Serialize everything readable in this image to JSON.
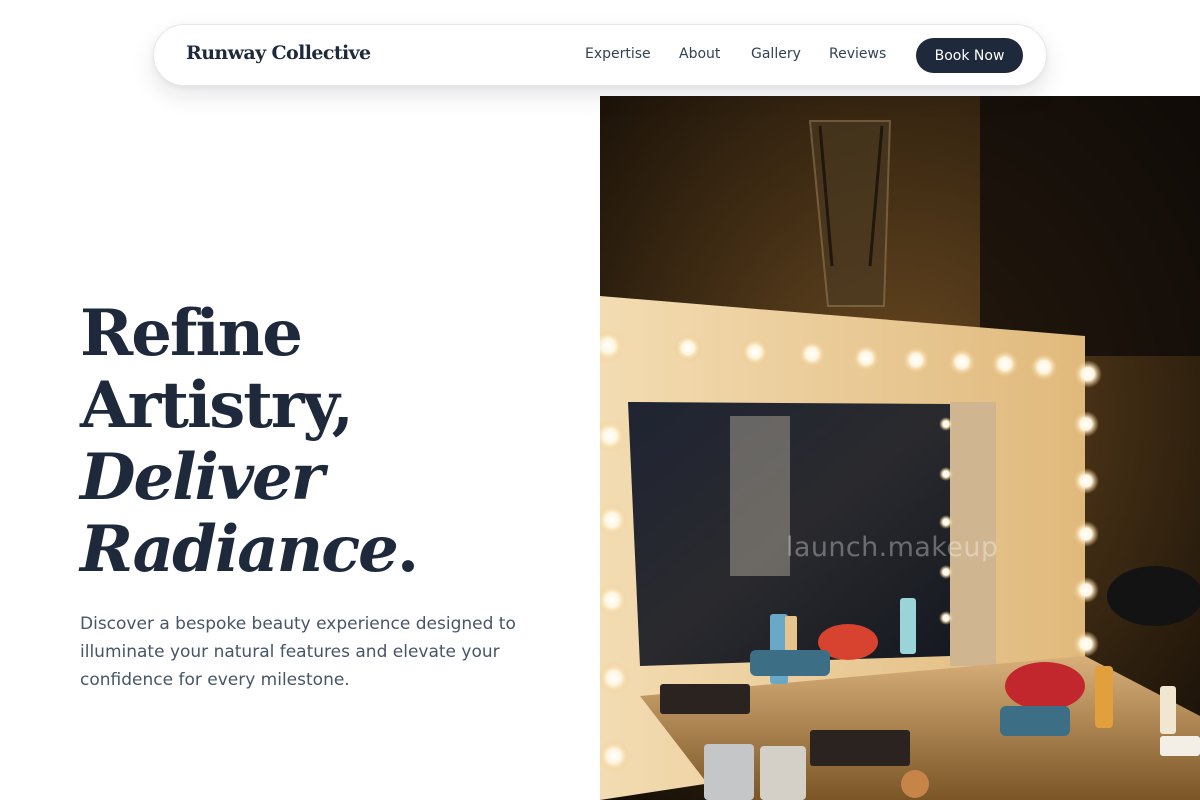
{
  "nav": {
    "brand": "Runway Collective",
    "links": [
      "Expertise",
      "About",
      "Gallery",
      "Reviews"
    ],
    "cta_label": "Book Now"
  },
  "hero": {
    "headline_line1": "Refine",
    "headline_line2": "Artistry,",
    "headline_line3": "Deliver",
    "headline_line4": "Radiance",
    "headline_punct": ".",
    "description": "Discover a bespoke beauty experience designed to illuminate your natural features and elevate your confidence for every milestone.",
    "image_watermark": "launch.makeup"
  },
  "colors": {
    "primary": "#1e293b",
    "body_text": "#475569",
    "background": "#ffffff"
  },
  "icons": {
    "hero_image": "vanity-mirror-photo"
  }
}
